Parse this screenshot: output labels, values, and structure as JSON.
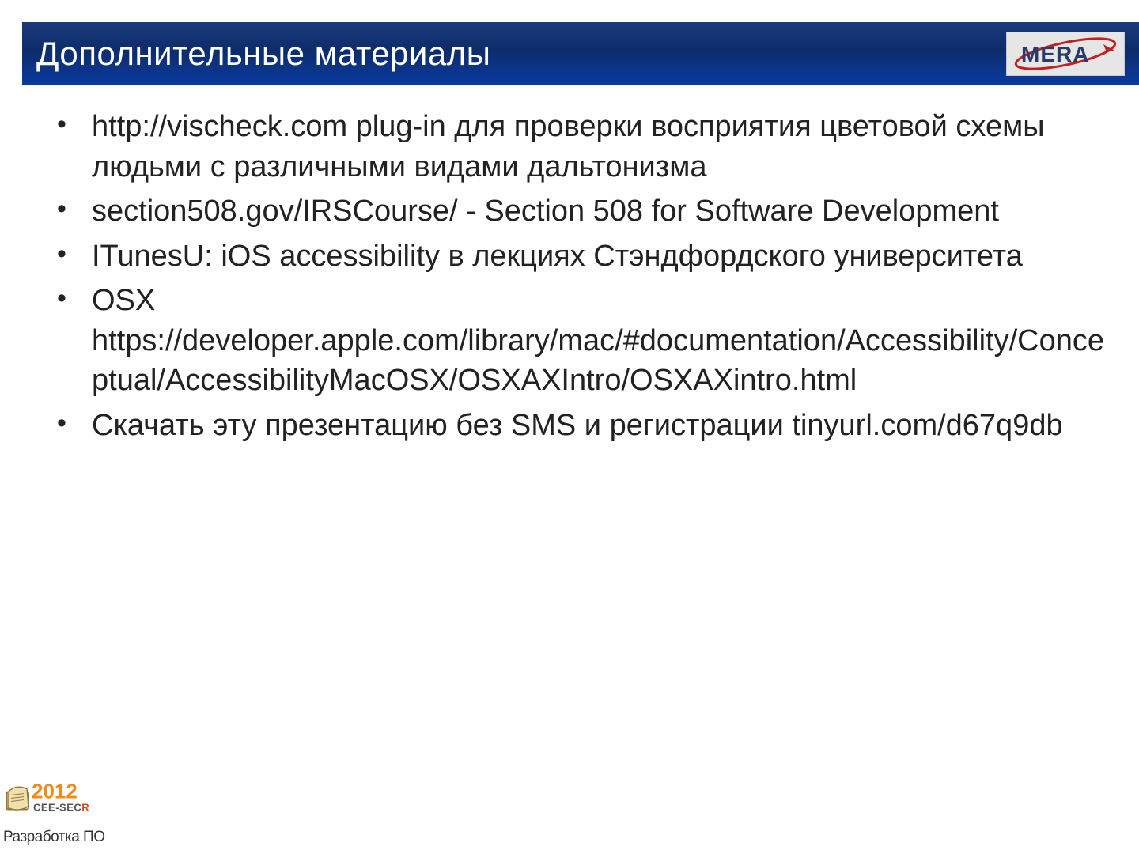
{
  "header": {
    "title": "Дополнительные материалы",
    "logo_text": "MERA"
  },
  "bullets": [
    "http://vischeck.com plug-in для проверки восприятия цветовой схемы людьми с различными видами дальтонизма",
    "section508.gov/IRSCourse/ - Section 508 for Software Development",
    "ITunesU: iOS accessibility в лекциях Стэндфордского университета",
    "OSX https://developer.apple.com/library/mac/#documentation/Accessibility/Conceptual/AccessibilityMacOSX/OSXAXIntro/OSXAXintro.html",
    "Скачать эту презентацию без SMS и регистрации tinyurl.com/d67q9db"
  ],
  "footer": {
    "year": "2012",
    "conf": "CEE-SECR",
    "tagline": "Разработка ПО"
  }
}
